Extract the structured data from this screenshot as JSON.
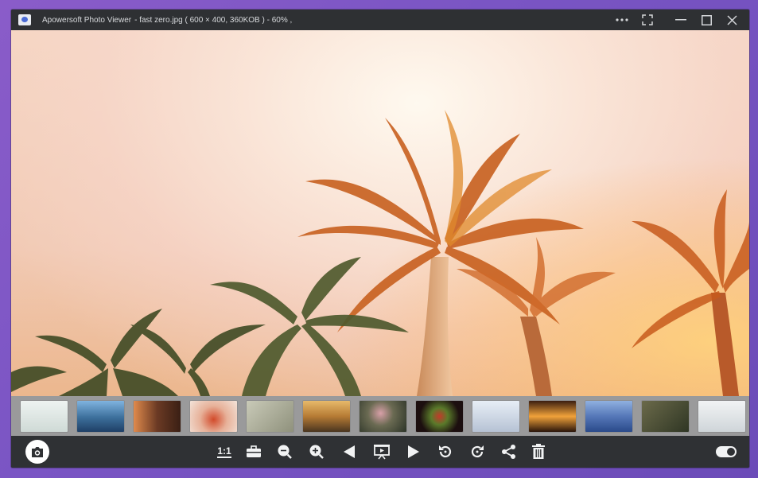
{
  "titlebar": {
    "app_name": "Apowersoft Photo Viewer",
    "file_info": "- fast zero.jpg ( 600 × 400,   360KOB )   - 60% ,",
    "more_icon": "more-horizontal-icon",
    "fullscreen_icon": "fullscreen-icon",
    "minimize_icon": "minimize-icon",
    "maximize_icon": "maximize-icon",
    "close_icon": "close-icon"
  },
  "image": {
    "subject": "palm trees against sunlit sky"
  },
  "filmstrip": {
    "thumbnails": [
      {
        "color": "#d9e4e3"
      },
      {
        "color": "#3b6e9a"
      },
      {
        "color": "#6b3a24"
      },
      {
        "color": "#e7b199"
      },
      {
        "color": "#a7a79a"
      },
      {
        "color": "#b67b34"
      },
      {
        "color": "#3f4a3a"
      },
      {
        "color": "#1c0f0f"
      },
      {
        "color": "#c6d1e0"
      },
      {
        "color": "#3b1e10"
      },
      {
        "color": "#5577b8"
      },
      {
        "color": "#3f4732"
      },
      {
        "color": "#dfe3e6"
      }
    ]
  },
  "toolbar": {
    "camera_icon": "camera-icon",
    "actual_size_label": "1:1",
    "items": [
      "toolbox-icon",
      "zoom-out-icon",
      "zoom-in-icon",
      "previous-icon",
      "slideshow-icon",
      "next-icon",
      "rotate-left-icon",
      "rotate-right-icon",
      "share-icon",
      "trash-icon"
    ],
    "toggle_icon": "toggle-switch-icon"
  }
}
